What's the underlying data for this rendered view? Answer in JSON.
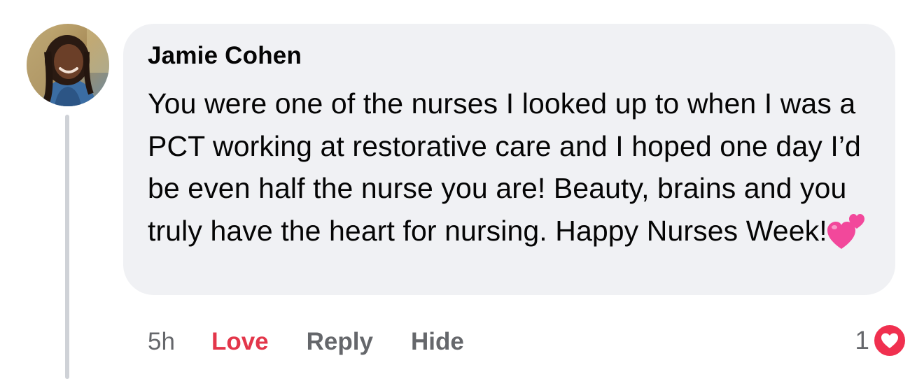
{
  "comment": {
    "author": "Jamie Cohen",
    "text": "You were one of the nurses I looked up to when I was a PCT working at restorative care and I hoped one day I’d be even half the nurse you are! Beauty, brains and you truly have the heart for nursing. Happy Nurses Week!",
    "text_emoji": "two-hearts-icon",
    "timestamp": "5h",
    "reaction_count": "1",
    "reaction_icon": "love-reaction-icon"
  },
  "actions": {
    "love_label": "Love",
    "reply_label": "Reply",
    "hide_label": "Hide"
  },
  "colors": {
    "bubble": "#f0f1f4",
    "love": "#e3364a",
    "muted": "#65676b",
    "reaction": "#f0304f"
  }
}
